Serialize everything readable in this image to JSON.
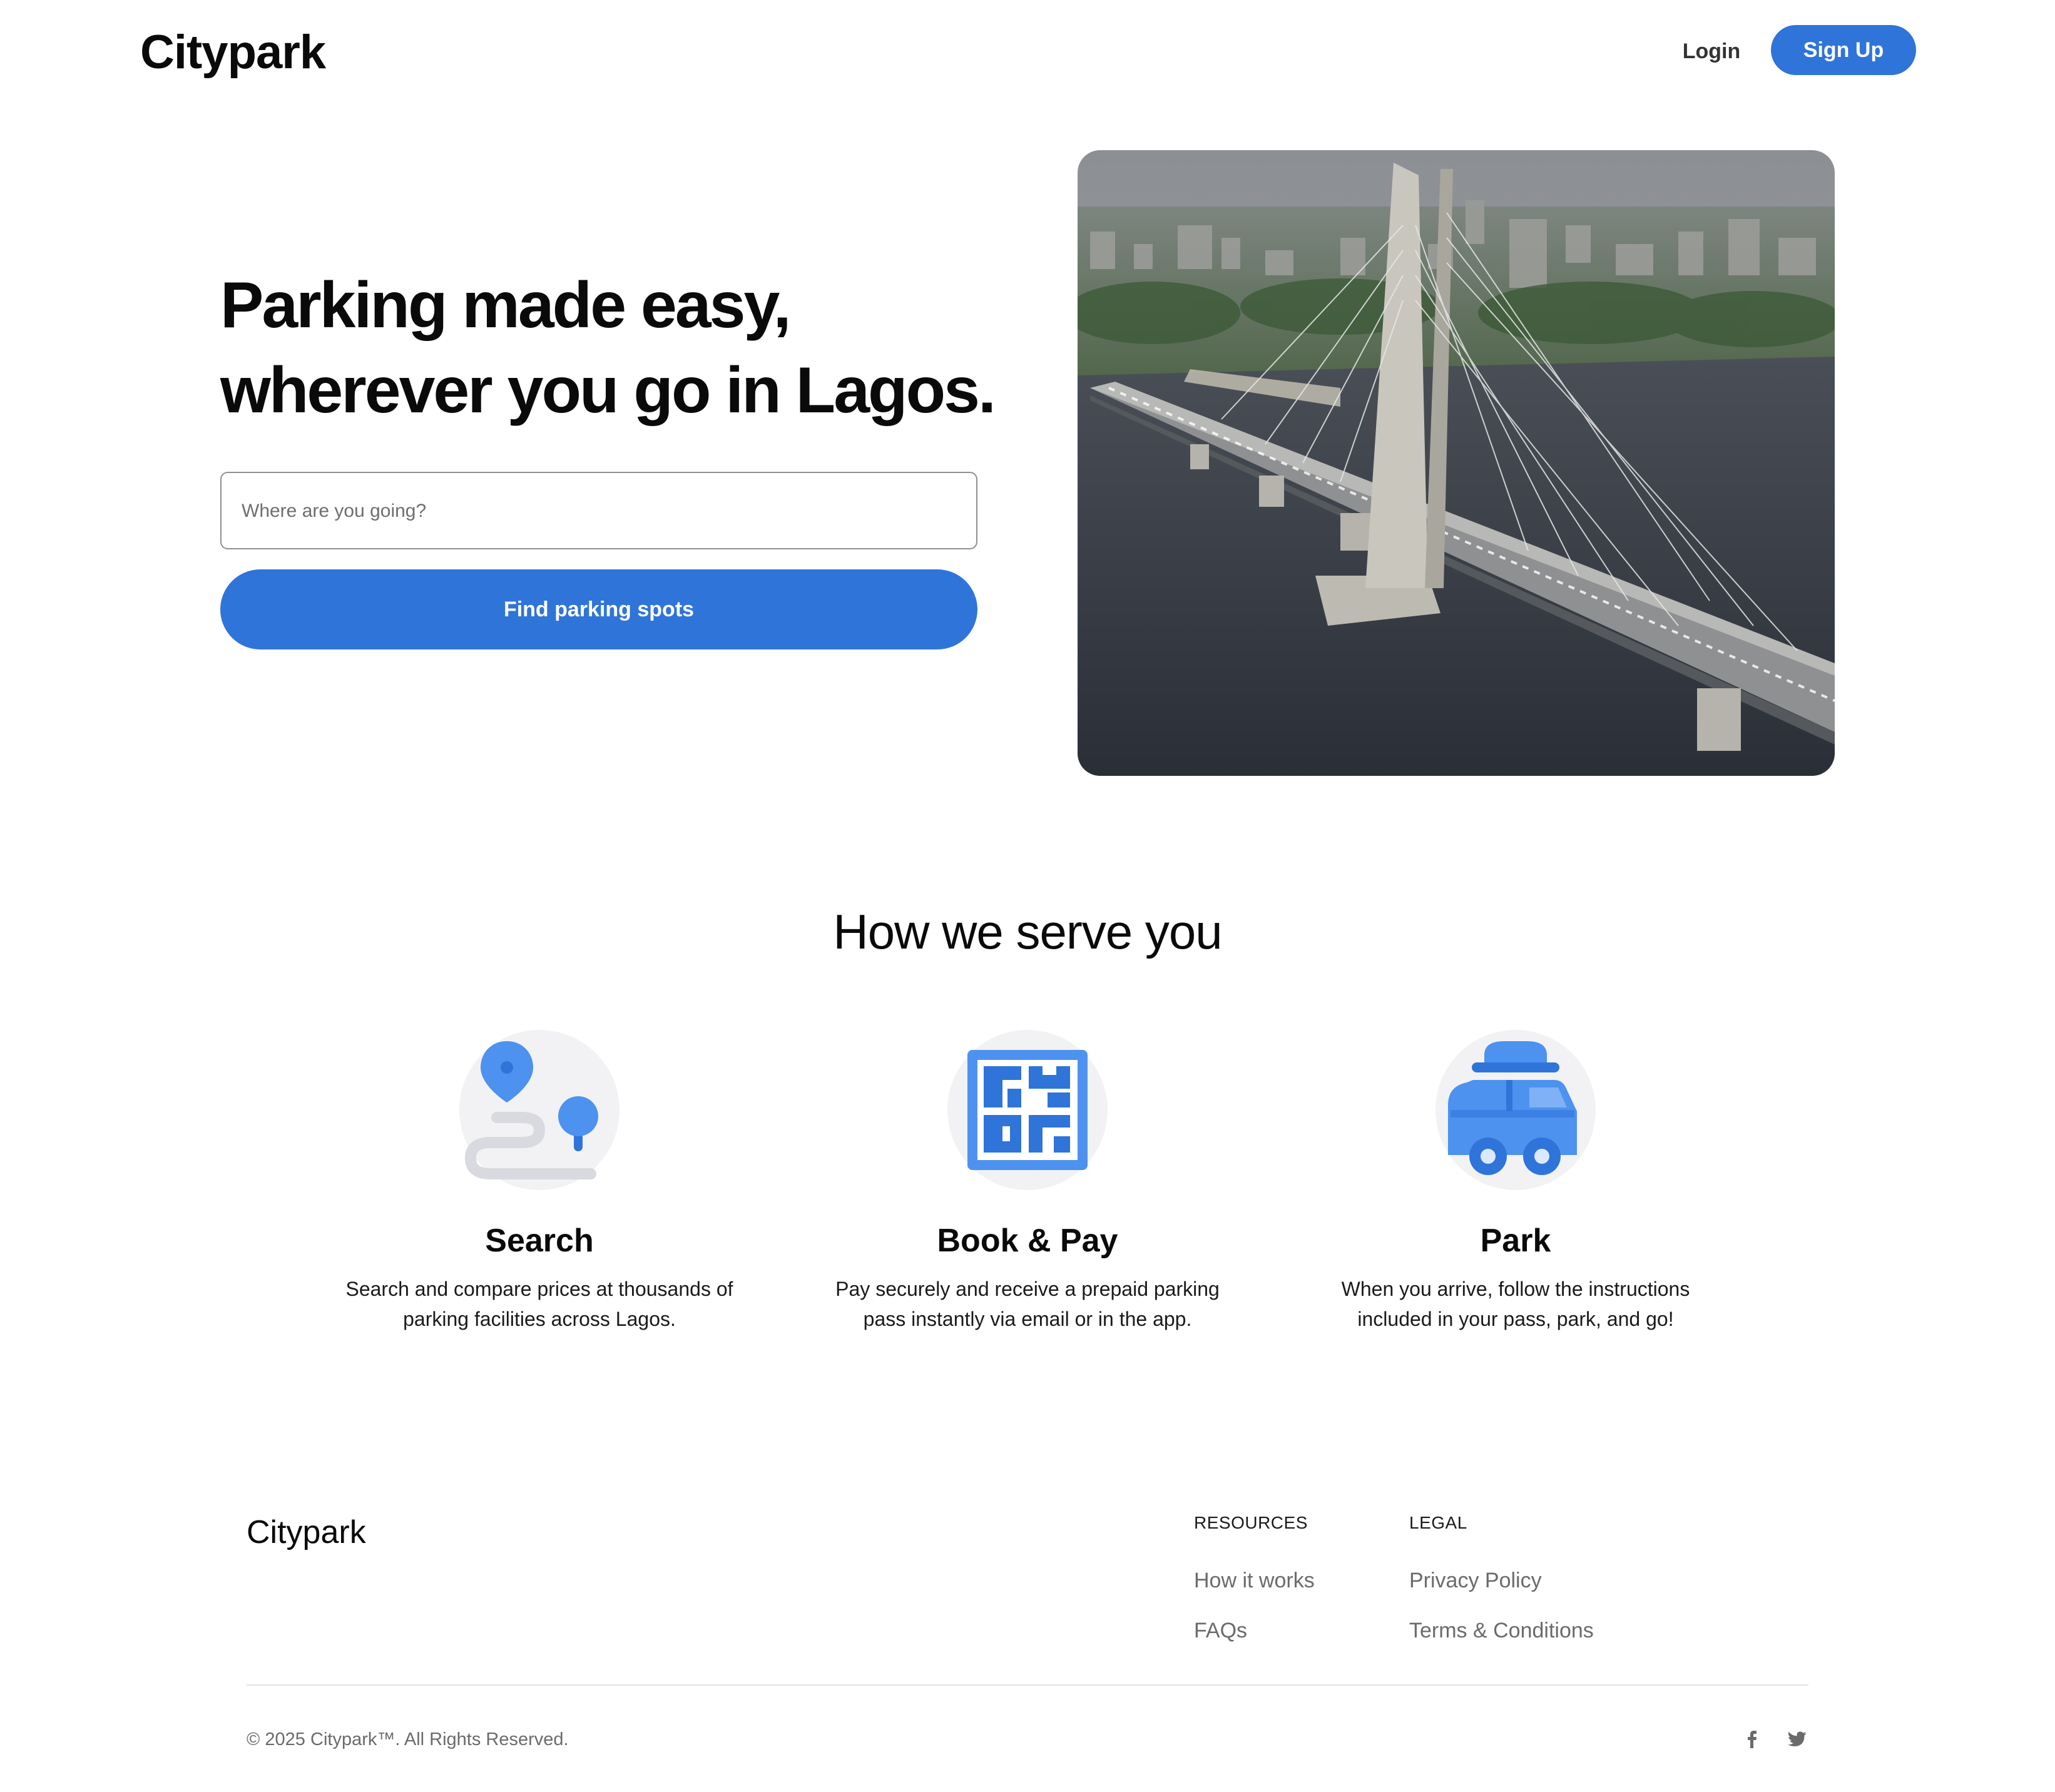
{
  "header": {
    "logo": "Citypark",
    "login_label": "Login",
    "signup_label": "Sign Up"
  },
  "hero": {
    "title_line1": "Parking made easy,",
    "title_line2": "wherever you go in Lagos.",
    "search_placeholder": "Where are you going?",
    "search_value": "",
    "cta_label": "Find parking spots",
    "image_subject": "Lekki-Ikoyi Link Bridge aerial photo"
  },
  "section": {
    "title": "How we serve you",
    "features": [
      {
        "icon": "route-pin-icon",
        "title": "Search",
        "line1": "Search and compare prices at thousands of",
        "line2": "parking facilities across Lagos."
      },
      {
        "icon": "qr-code-icon",
        "title": "Book & Pay",
        "line1": "Pay securely and receive a prepaid parking",
        "line2": "pass instantly via email or in the app."
      },
      {
        "icon": "car-icon",
        "title": "Park",
        "line1": "When you arrive, follow the instructions",
        "line2": "included in your pass, park, and go!"
      }
    ]
  },
  "footer": {
    "logo": "Citypark",
    "resources": {
      "heading": "RESOURCES",
      "links": [
        "How it works",
        "FAQs"
      ]
    },
    "legal": {
      "heading": "LEGAL",
      "links": [
        "Privacy Policy",
        "Terms & Conditions"
      ]
    },
    "copyright": "© 2025 Citypark™. All Rights Reserved.",
    "social": [
      "facebook-icon",
      "twitter-icon"
    ]
  },
  "colors": {
    "accent": "#2f74d9",
    "icon_blue": "#4e92f0",
    "icon_blue_dark": "#2f74d9",
    "icon_bg": "#f2f2f4",
    "muted_text": "#6b6b6b"
  }
}
